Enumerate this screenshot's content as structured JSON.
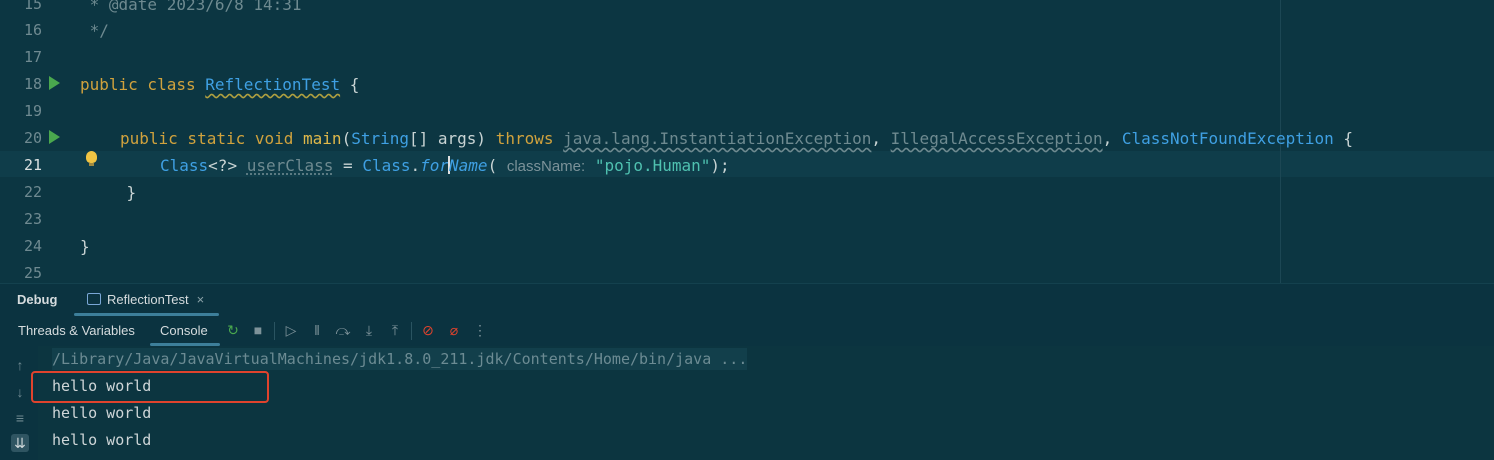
{
  "editor": {
    "lines": [
      {
        "num": "15",
        "text": " * @date 2023/6/8 14:31"
      },
      {
        "num": "16",
        "text": " */"
      },
      {
        "num": "17",
        "text": ""
      },
      {
        "num": "18",
        "kw1": "public class ",
        "cls": "ReflectionTest",
        "rest": " {"
      },
      {
        "num": "19",
        "text": ""
      },
      {
        "num": "20",
        "kw1": "public static void ",
        "fn": "main",
        "p1": "(",
        "ty1": "String",
        "p2": "[] args) ",
        "kw2": "throws ",
        "e1": "java.lang.InstantiationException",
        "c1": ", ",
        "e2": "IllegalAccessException",
        "c2": ", ",
        "ty2": "ClassNotFoundException",
        "p3": " {"
      },
      {
        "num": "21",
        "ty1": "Class",
        "p1": "<?> ",
        "var": "userClass",
        "p2": " = ",
        "ty2": "Class",
        "p3": ".",
        "m1": "for",
        "m2": "Name",
        "p4": "( ",
        "hint": "className:",
        "str": " \"pojo.Human\"",
        "p5": ");"
      },
      {
        "num": "22",
        "text": "    }"
      },
      {
        "num": "23",
        "text": ""
      },
      {
        "num": "24",
        "text": "}"
      },
      {
        "num": "25",
        "text": ""
      }
    ]
  },
  "debug": {
    "panel_label": "Debug",
    "tab_label": "ReflectionTest",
    "tab_close": "×"
  },
  "toolbar": {
    "threads_label": "Threads & Variables",
    "console_label": "Console",
    "icons": [
      "rerun-icon",
      "stop-icon",
      "resume-icon",
      "pause-icon",
      "step-over-icon",
      "step-into-icon",
      "step-out-icon",
      "breakpoints-icon",
      "mute-breakpoints-icon",
      "more-icon"
    ]
  },
  "console": {
    "command": "/Library/Java/JavaVirtualMachines/jdk1.8.0_211.jdk/Contents/Home/bin/java ...",
    "output": [
      "hello world",
      "hello world",
      "hello world"
    ]
  },
  "colors": {
    "highlight_box": "#e0432d",
    "keyword": "#d0a23d",
    "type": "#3fa0e3",
    "string": "#4fc1b0"
  }
}
